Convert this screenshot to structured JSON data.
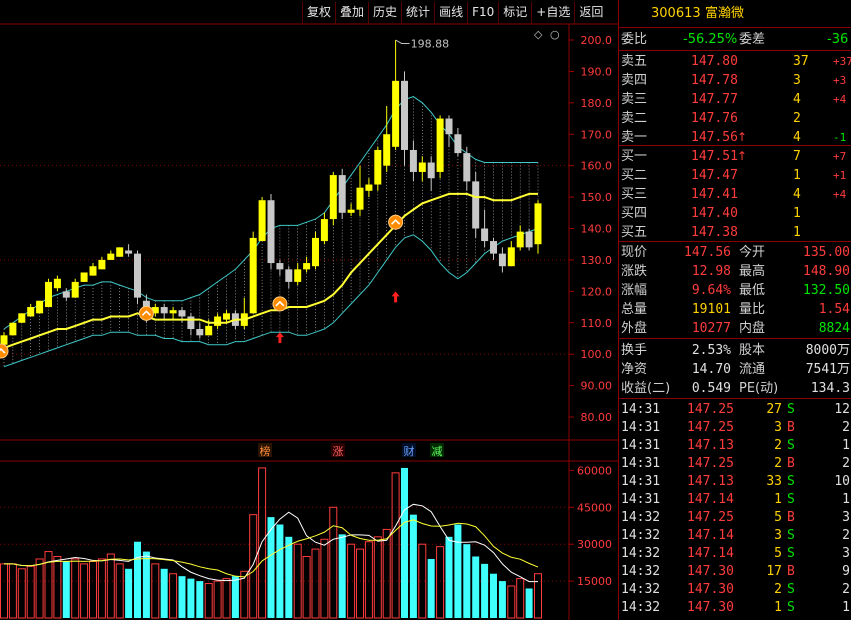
{
  "toolbar": [
    "复权",
    "叠加",
    "历史",
    "统计",
    "画线",
    "F10",
    "标记",
    "+自选",
    "返回"
  ],
  "stock": {
    "code": "300613",
    "name": "富瀚微"
  },
  "header_row": {
    "wb_label": "委比",
    "wb_value": "-56.25%",
    "wc_label": "委差",
    "wc_value": "-36"
  },
  "asks": [
    {
      "label": "卖五",
      "price": "147.80",
      "vol": "37",
      "chg": "+37",
      "arrow": ""
    },
    {
      "label": "卖四",
      "price": "147.78",
      "vol": "3",
      "chg": "+3",
      "arrow": ""
    },
    {
      "label": "卖三",
      "price": "147.77",
      "vol": "4",
      "chg": "+4",
      "arrow": ""
    },
    {
      "label": "卖二",
      "price": "147.76",
      "vol": "2",
      "chg": "",
      "arrow": ""
    },
    {
      "label": "卖一",
      "price": "147.56",
      "vol": "4",
      "chg": "-1",
      "arrow": "↑"
    }
  ],
  "bids": [
    {
      "label": "买一",
      "price": "147.51",
      "vol": "7",
      "chg": "+7",
      "arrow": "↑"
    },
    {
      "label": "买二",
      "price": "147.47",
      "vol": "1",
      "chg": "+1",
      "arrow": ""
    },
    {
      "label": "买三",
      "price": "147.41",
      "vol": "4",
      "chg": "+4",
      "arrow": ""
    },
    {
      "label": "买四",
      "price": "147.40",
      "vol": "1",
      "chg": "",
      "arrow": ""
    },
    {
      "label": "买五",
      "price": "147.38",
      "vol": "1",
      "chg": "",
      "arrow": ""
    }
  ],
  "stats": [
    {
      "l1": "现价",
      "v1": "147.56",
      "c1": "red",
      "l2": "今开",
      "v2": "135.00",
      "c2": "red"
    },
    {
      "l1": "涨跌",
      "v1": "12.98",
      "c1": "red",
      "l2": "最高",
      "v2": "148.90",
      "c2": "red"
    },
    {
      "l1": "涨幅",
      "v1": "9.64%",
      "c1": "red",
      "l2": "最低",
      "v2": "132.50",
      "c2": "grn"
    },
    {
      "l1": "总量",
      "v1": "19101",
      "c1": "yel",
      "l2": "量比",
      "v2": "1.54",
      "c2": "red"
    },
    {
      "l1": "外盘",
      "v1": "10277",
      "c1": "red",
      "l2": "内盘",
      "v2": "8824",
      "c2": "grn"
    }
  ],
  "fund": [
    {
      "l1": "换手",
      "v1": "2.53%",
      "l2": "股本",
      "v2": "8000万"
    },
    {
      "l1": "净资",
      "v1": "14.70",
      "l2": "流通",
      "v2": "7541万"
    },
    {
      "l1": "收益(二)",
      "v1": "0.549",
      "l2": "PE(动)",
      "v2": "134.3"
    }
  ],
  "ticks": [
    {
      "t": "14:31",
      "p": "147.25",
      "v": "27",
      "d": "S",
      "n": "12"
    },
    {
      "t": "14:31",
      "p": "147.25",
      "v": "3",
      "d": "B",
      "n": "2"
    },
    {
      "t": "14:31",
      "p": "147.13",
      "v": "2",
      "d": "S",
      "n": "1"
    },
    {
      "t": "14:31",
      "p": "147.25",
      "v": "2",
      "d": "B",
      "n": "2"
    },
    {
      "t": "14:31",
      "p": "147.13",
      "v": "33",
      "d": "S",
      "n": "10"
    },
    {
      "t": "14:31",
      "p": "147.14",
      "v": "1",
      "d": "S",
      "n": "1"
    },
    {
      "t": "14:32",
      "p": "147.25",
      "v": "5",
      "d": "B",
      "n": "3"
    },
    {
      "t": "14:32",
      "p": "147.14",
      "v": "3",
      "d": "S",
      "n": "2"
    },
    {
      "t": "14:32",
      "p": "147.14",
      "v": "5",
      "d": "S",
      "n": "3"
    },
    {
      "t": "14:32",
      "p": "147.30",
      "v": "17",
      "d": "B",
      "n": "9"
    },
    {
      "t": "14:32",
      "p": "147.30",
      "v": "2",
      "d": "S",
      "n": "2"
    },
    {
      "t": "14:32",
      "p": "147.30",
      "v": "1",
      "d": "S",
      "n": "1"
    }
  ],
  "chart_data": {
    "type": "candlestick",
    "price_axis": [
      "200.0",
      "190.0",
      "180.0",
      "170.0",
      "160.0",
      "150.0",
      "140.0",
      "130.0",
      "120.0",
      "110.0",
      "100.0",
      "90.00",
      "80.00"
    ],
    "price_range": [
      80,
      200
    ],
    "volume_axis": [
      "60000",
      "45000",
      "30000",
      "15000"
    ],
    "volume_range": [
      0,
      63000
    ],
    "peak_label": "198.88",
    "markers": [
      "榜",
      "涨",
      "财",
      "减"
    ],
    "colors": {
      "up": "#ffff00",
      "down": "#c8c8c8",
      "ma": "#ffff33",
      "band": "#40c8c8",
      "vol_up": "#ff3c3c",
      "vol_down": "#40ffff"
    },
    "candles": [
      [
        103,
        106,
        103,
        107
      ],
      [
        106,
        110,
        106,
        110
      ],
      [
        110,
        113,
        110,
        113
      ],
      [
        112,
        115,
        112,
        116
      ],
      [
        113,
        117,
        113,
        117
      ],
      [
        115,
        123,
        115,
        124
      ],
      [
        121,
        124,
        120,
        125
      ],
      [
        120,
        118,
        117,
        121
      ],
      [
        118,
        123,
        118,
        124
      ],
      [
        123,
        126,
        123,
        126
      ],
      [
        125,
        128,
        125,
        129
      ],
      [
        127,
        130,
        127,
        131
      ],
      [
        130,
        132,
        130,
        133
      ],
      [
        131,
        134,
        131,
        134
      ],
      [
        133,
        132,
        131,
        135
      ],
      [
        132,
        118,
        116,
        133
      ],
      [
        117,
        113,
        110,
        119
      ],
      [
        113,
        115,
        112,
        116
      ],
      [
        115,
        113,
        111,
        116
      ],
      [
        113,
        114,
        111,
        115
      ],
      [
        114,
        112,
        110,
        115
      ],
      [
        112,
        108,
        106,
        113
      ],
      [
        108,
        106,
        105,
        110
      ],
      [
        106,
        109,
        106,
        111
      ],
      [
        109,
        112,
        108,
        113
      ],
      [
        111,
        113,
        110,
        114
      ],
      [
        113,
        109,
        108,
        114
      ],
      [
        109,
        113,
        108,
        118
      ],
      [
        113,
        137,
        113,
        139
      ],
      [
        136,
        149,
        136,
        150
      ],
      [
        149,
        129,
        127,
        151
      ],
      [
        129,
        127,
        125,
        130
      ],
      [
        127,
        123,
        121,
        128
      ],
      [
        123,
        127,
        122,
        129
      ],
      [
        127,
        129,
        126,
        131
      ],
      [
        128,
        137,
        127,
        139
      ],
      [
        136,
        143,
        135,
        145
      ],
      [
        143,
        157,
        141,
        158
      ],
      [
        157,
        145,
        143,
        159
      ],
      [
        145,
        146,
        144,
        148
      ],
      [
        146,
        153,
        144,
        160
      ],
      [
        152,
        154,
        150,
        156
      ],
      [
        154,
        165,
        152,
        166
      ],
      [
        160,
        170,
        158,
        179
      ],
      [
        166,
        187,
        165,
        200
      ],
      [
        187,
        165,
        160,
        190
      ],
      [
        165,
        158,
        155,
        168
      ],
      [
        158,
        161,
        155,
        163
      ],
      [
        161,
        156,
        152,
        163
      ],
      [
        158,
        175,
        156,
        176
      ],
      [
        175,
        170,
        166,
        176
      ],
      [
        170,
        164,
        163,
        172
      ],
      [
        164,
        155,
        152,
        166
      ],
      [
        155,
        140,
        137,
        158
      ],
      [
        140,
        136,
        134,
        146
      ],
      [
        136,
        132,
        130,
        137
      ],
      [
        132,
        128,
        126,
        134
      ],
      [
        128,
        134,
        128,
        136
      ],
      [
        134,
        139,
        133,
        141
      ],
      [
        139,
        134,
        133,
        140
      ],
      [
        135,
        148,
        132,
        149
      ]
    ],
    "ma": [
      102,
      103,
      104,
      105,
      106,
      107,
      108,
      108,
      109,
      110,
      111,
      111,
      112,
      112,
      112,
      113,
      112,
      111,
      111,
      111,
      111,
      111,
      111,
      110,
      110,
      110,
      111,
      111,
      112,
      113,
      114,
      114,
      115,
      115,
      115,
      116,
      117,
      119,
      122,
      126,
      129,
      132,
      135,
      138,
      141,
      144,
      146,
      148,
      149,
      150,
      151,
      151,
      151,
      150,
      150,
      149,
      149,
      149,
      150,
      151,
      151
    ],
    "band_upper": [
      108,
      110,
      112,
      114,
      116,
      118,
      119,
      120,
      121,
      122,
      122,
      123,
      123,
      122,
      121,
      120,
      118,
      117,
      117,
      117,
      117,
      118,
      119,
      121,
      123,
      125,
      127,
      130,
      133,
      137,
      140,
      141,
      141,
      141,
      142,
      143,
      145,
      149,
      153,
      157,
      161,
      165,
      169,
      173,
      178,
      181,
      182,
      180,
      177,
      173,
      170,
      166,
      164,
      162,
      161,
      161,
      161,
      161,
      161,
      161,
      161
    ],
    "band_lower": [
      96,
      97,
      98,
      99,
      100,
      101,
      102,
      103,
      104,
      105,
      106,
      106,
      107,
      107,
      107,
      106,
      106,
      106,
      105,
      105,
      104,
      104,
      104,
      103,
      103,
      103,
      104,
      104,
      105,
      106,
      107,
      107,
      107,
      106,
      106,
      107,
      108,
      110,
      113,
      116,
      119,
      122,
      126,
      130,
      134,
      137,
      138,
      136,
      133,
      129,
      126,
      124,
      126,
      129,
      132,
      134,
      136,
      137,
      138,
      139,
      140
    ],
    "volumes": [
      22000,
      22000,
      20000,
      21000,
      24000,
      27000,
      25000,
      23000,
      24000,
      22000,
      23000,
      24000,
      26000,
      22000,
      20000,
      31000,
      27000,
      22000,
      20000,
      18000,
      17000,
      16000,
      15000,
      14000,
      15000,
      16000,
      17000,
      19000,
      42000,
      61000,
      41000,
      38000,
      33000,
      30000,
      25000,
      28000,
      32000,
      45000,
      34000,
      30000,
      28000,
      31000,
      33000,
      36000,
      59000,
      61000,
      42000,
      30000,
      24000,
      29000,
      33000,
      38000,
      30000,
      25000,
      22000,
      18000,
      15000,
      13000,
      16000,
      12000,
      18000
    ]
  }
}
